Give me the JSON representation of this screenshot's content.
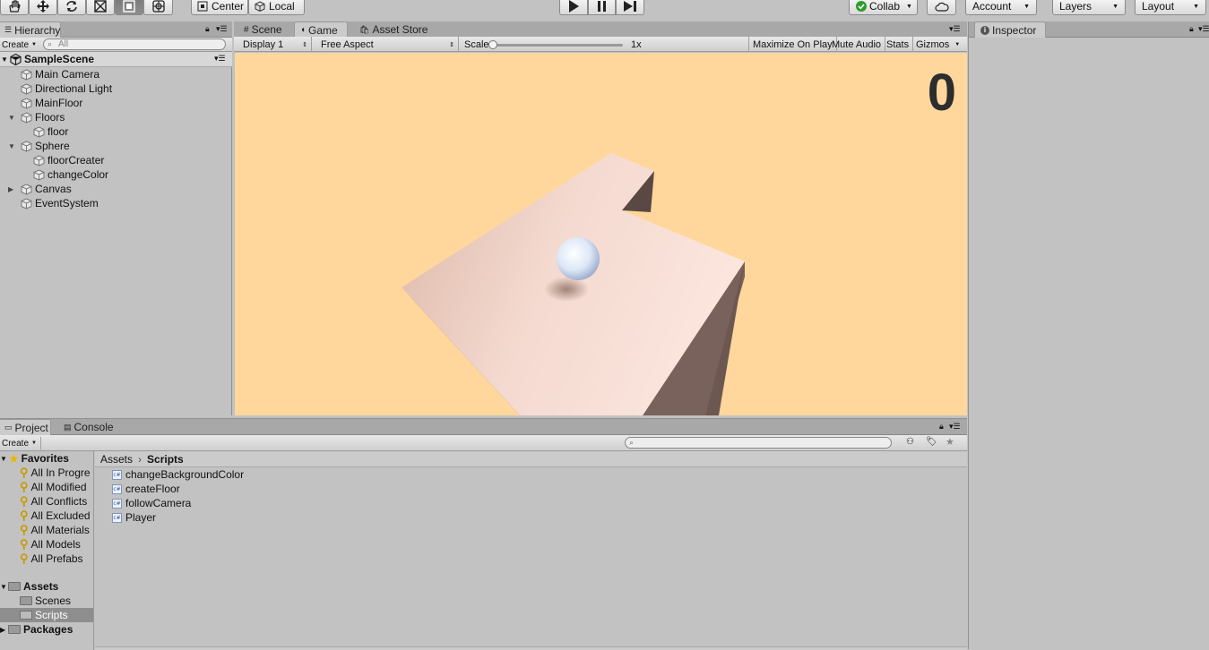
{
  "toolbar": {
    "center_label": "Center",
    "local_label": "Local",
    "collab_label": "Collab",
    "account_label": "Account",
    "layers_label": "Layers",
    "layout_label": "Layout"
  },
  "hierarchy": {
    "tab_label": "Hierarchy",
    "create_label": "Create",
    "search_placeholder": "All",
    "scene_name": "SampleScene",
    "items": [
      {
        "label": "Main Camera"
      },
      {
        "label": "Directional Light"
      },
      {
        "label": "MainFloor"
      },
      {
        "label": "Floors"
      },
      {
        "label": "floor"
      },
      {
        "label": "Sphere"
      },
      {
        "label": "floorCreater"
      },
      {
        "label": "changeColor"
      },
      {
        "label": "Canvas"
      },
      {
        "label": "EventSystem"
      }
    ]
  },
  "center_tabs": [
    {
      "label": "Scene"
    },
    {
      "label": "Game"
    },
    {
      "label": "Asset Store"
    }
  ],
  "game_toolbar": {
    "display": "Display 1",
    "aspect": "Free Aspect",
    "scale_label": "Scale",
    "scale_value": "1x",
    "maximize": "Maximize On Play",
    "mute": "Mute Audio",
    "stats": "Stats",
    "gizmos": "Gizmos"
  },
  "game_view": {
    "score": "0",
    "background_color": "#ffd79c"
  },
  "inspector": {
    "tab_label": "Inspector"
  },
  "bottom_tabs": [
    {
      "label": "Project"
    },
    {
      "label": "Console"
    }
  ],
  "project": {
    "create_label": "Create",
    "favorites_label": "Favorites",
    "favorites": [
      {
        "label": "All In Progre"
      },
      {
        "label": "All Modified"
      },
      {
        "label": "All Conflicts"
      },
      {
        "label": "All Excluded"
      },
      {
        "label": "All Materials"
      },
      {
        "label": "All Models"
      },
      {
        "label": "All Prefabs"
      }
    ],
    "assets_label": "Assets",
    "asset_folders": [
      {
        "label": "Scenes"
      },
      {
        "label": "Scripts"
      }
    ],
    "packages_label": "Packages",
    "breadcrumb": {
      "root": "Assets",
      "current": "Scripts"
    },
    "files": [
      {
        "label": "changeBackgroundColor"
      },
      {
        "label": "createFloor"
      },
      {
        "label": "followCamera"
      },
      {
        "label": "Player"
      }
    ]
  }
}
